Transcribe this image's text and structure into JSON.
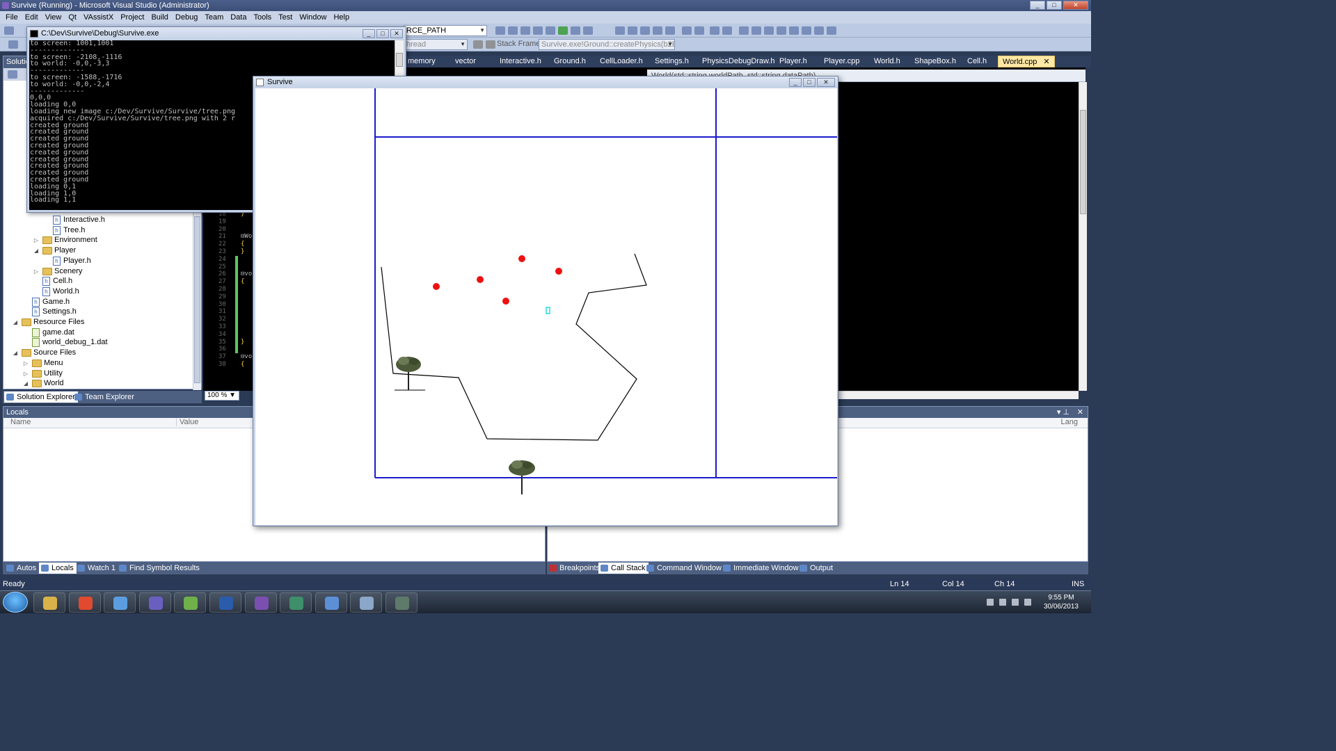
{
  "vs": {
    "title": "Survive (Running) - Microsoft Visual Studio (Administrator)",
    "menu": [
      "File",
      "Edit",
      "View",
      "Qt",
      "VAssistX",
      "Project",
      "Build",
      "Debug",
      "Team",
      "Data",
      "Tools",
      "Test",
      "Window",
      "Help"
    ],
    "toolbar": {
      "config_combo": "RCE_PATH",
      "thread_combo": "hread",
      "stack_frame_label": "Stack Frame:",
      "stack_frame_value": "Survive.exe!Ground::createPhysics(b2Body"
    },
    "doc_tabs": [
      "memory",
      "vector",
      "Interactive.h",
      "Ground.h",
      "CellLoader.h",
      "Settings.h",
      "PhysicsDebugDraw.h",
      "Player.h",
      "Player.cpp",
      "World.h",
      "ShapeBox.h",
      "Cell.h",
      "World.cpp"
    ],
    "active_tab": "World.cpp",
    "nav_bar": "World(std::string worldPath, std::string dataPath)"
  },
  "solution_explorer": {
    "header": "Solutio",
    "items": [
      {
        "label": "Interactive.h",
        "type": "header",
        "indent": 5
      },
      {
        "label": "Tree.h",
        "type": "header",
        "indent": 5
      },
      {
        "label": "Environment",
        "type": "folder",
        "indent": 4,
        "expander": "▷"
      },
      {
        "label": "Player",
        "type": "folder",
        "indent": 4,
        "expander": "◢"
      },
      {
        "label": "Player.h",
        "type": "header",
        "indent": 5
      },
      {
        "label": "Scenery",
        "type": "folder",
        "indent": 4,
        "expander": "▷"
      },
      {
        "label": "Cell.h",
        "type": "header",
        "indent": 4
      },
      {
        "label": "World.h",
        "type": "header",
        "indent": 4
      },
      {
        "label": "Game.h",
        "type": "header",
        "indent": 3
      },
      {
        "label": "Settings.h",
        "type": "header",
        "indent": 3
      },
      {
        "label": "Resource Files",
        "type": "folder",
        "indent": 2,
        "expander": "◢"
      },
      {
        "label": "game.dat",
        "type": "dat",
        "indent": 3
      },
      {
        "label": "world_debug_1.dat",
        "type": "dat",
        "indent": 3
      },
      {
        "label": "Source Files",
        "type": "folder",
        "indent": 2,
        "expander": "◢"
      },
      {
        "label": "Menu",
        "type": "folder",
        "indent": 3,
        "expander": "▷"
      },
      {
        "label": "Utility",
        "type": "folder",
        "indent": 3,
        "expander": "▷"
      },
      {
        "label": "World",
        "type": "folder",
        "indent": 3,
        "expander": "◢"
      }
    ],
    "bottom_tabs": [
      "Solution Explorer",
      "Team Explorer"
    ]
  },
  "editor": {
    "line_numbers": [
      "18",
      "19",
      "20",
      "21",
      "22",
      "23",
      "24",
      "25",
      "26",
      "27",
      "28",
      "29",
      "30",
      "31",
      "32",
      "33",
      "34",
      "35",
      "36",
      "37",
      "38"
    ],
    "code_fragments": [
      {
        "line": 18,
        "text": "}"
      },
      {
        "line": 21,
        "text": "⊟Wo"
      },
      {
        "line": 22,
        "text": "{"
      },
      {
        "line": 23,
        "text": "}"
      },
      {
        "line": 26,
        "text": "⊟vo"
      },
      {
        "line": 27,
        "text": "{"
      },
      {
        "line": 35,
        "text": "}"
      },
      {
        "line": 37,
        "text": "⊟vo"
      },
      {
        "line": 38,
        "text": "{"
      }
    ],
    "zoom": "100 %"
  },
  "locals": {
    "header": "Locals",
    "columns": [
      "Name",
      "Value"
    ],
    "right_col": "Lang"
  },
  "bottom_tabs_left": [
    "Autos",
    "Locals",
    "Watch 1",
    "Find Symbol Results"
  ],
  "bottom_tabs_right": [
    "Breakpoints",
    "Call Stack",
    "Command Window",
    "Immediate Window",
    "Output"
  ],
  "active_bottom_left": "Locals",
  "active_bottom_right": "Call Stack",
  "status": {
    "ready": "Ready",
    "ln": "Ln 14",
    "col": "Col 14",
    "ch": "Ch 14",
    "ins": "INS"
  },
  "console": {
    "title": "C:\\Dev\\Survive\\Debug\\Survive.exe",
    "lines": [
      "to screen: 1001,1001",
      "-------------",
      "to screen: -2108,-1116",
      "to world: -0,0,-3,3",
      "-------------",
      "to screen: -1588,-1716",
      "to world: -0,0,-2,4",
      "-------------",
      "0,0,0",
      "loading 0,0",
      "loading new image c:/Dev/Survive/Survive/tree.png",
      "acquired c:/Dev/Survive/Survive/tree.png with 2 r",
      "created ground",
      "created ground",
      "created ground",
      "created ground",
      "created ground",
      "created ground",
      "created ground",
      "created ground",
      "created ground",
      "loading 0,1",
      "loading 1,0",
      "loading 1,1"
    ]
  },
  "game": {
    "title": "Survive",
    "colors": {
      "grid": "#1a1acc",
      "enemy": "#ee1111",
      "player": "#22dddd",
      "ground": "#000000"
    }
  },
  "taskbar": {
    "apps": [
      "windows-explorer",
      "chrome",
      "itunes",
      "visual-studio-infinity",
      "notepad-plus",
      "word",
      "eclipse",
      "network-app",
      "control-panel",
      "virtualbox",
      "game-window"
    ],
    "time": "9:55 PM",
    "date": "30/06/2013"
  }
}
